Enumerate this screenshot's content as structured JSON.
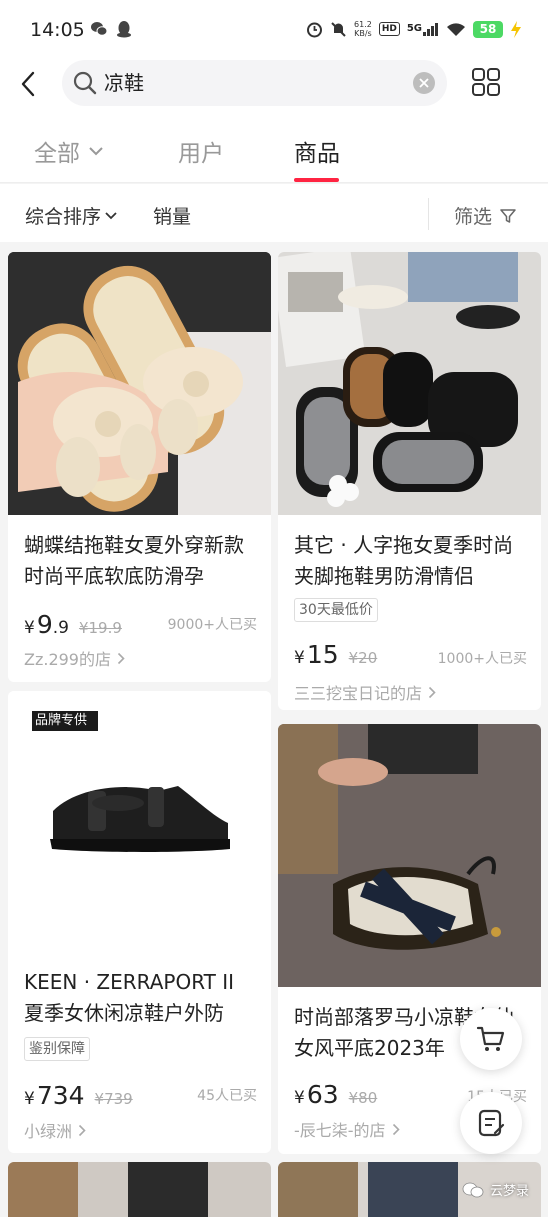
{
  "status_bar": {
    "time": "14:05",
    "net_speed_value": "61.2",
    "net_speed_unit": "KB/s",
    "hd": "HD",
    "network": "5G",
    "battery": "58"
  },
  "header": {
    "search_value": "凉鞋",
    "icons": [
      "back-arrow-icon",
      "search-icon",
      "clear-icon",
      "grid-icon"
    ]
  },
  "tabs": [
    {
      "label": "全部",
      "active": false
    },
    {
      "label": "用户",
      "active": false
    },
    {
      "label": "商品",
      "active": true
    }
  ],
  "sort": {
    "comprehensive": "综合排序",
    "sales": "销量",
    "filter": "筛选"
  },
  "products": [
    {
      "title": "蝴蝶结拖鞋女夏外穿新款时尚平底软底防滑孕",
      "price": "9",
      "price_decimal": ".9",
      "original_price": "¥19.9",
      "sold": "9000+人已买",
      "shop": "Zz.299的店"
    },
    {
      "title": "其它 · 人字拖女夏季时尚夹脚拖鞋男防滑情侣",
      "tag": "30天最低价",
      "price": "15",
      "original_price": "¥20",
      "sold": "1000+人已买",
      "shop": "三三挖宝日记的店"
    },
    {
      "brand_badge": "品牌专供",
      "title": "KEEN · ZERRAPORT II 夏季女休闲凉鞋户外防",
      "tag": "鉴别保障",
      "price": "734",
      "original_price": "¥739",
      "sold": "45人已买",
      "shop": "小绿洲"
    },
    {
      "title": "时尚部落罗马小凉鞋女仙女风平底2023年",
      "price": "63",
      "original_price": "¥80",
      "sold": "15人已买",
      "shop": "-辰七柒-的店"
    }
  ],
  "currency": "¥",
  "watermark": "云梦录",
  "colors": {
    "accent": "#ff2442",
    "text": "#222222",
    "muted": "#aaaaaa"
  }
}
